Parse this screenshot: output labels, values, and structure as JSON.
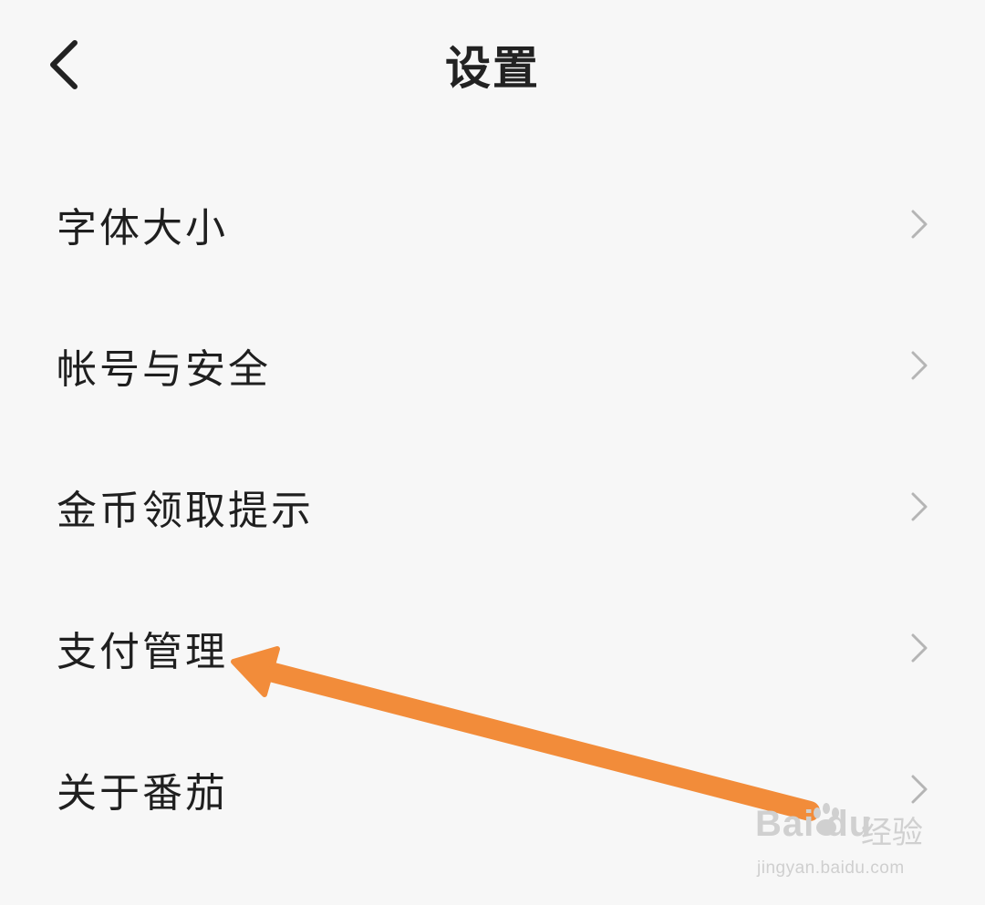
{
  "header": {
    "title": "设置",
    "back_icon": "chevron-left-icon"
  },
  "menu": {
    "items": [
      {
        "label": "字体大小",
        "icon": "chevron-right-icon"
      },
      {
        "label": "帐号与安全",
        "icon": "chevron-right-icon"
      },
      {
        "label": "金币领取提示",
        "icon": "chevron-right-icon"
      },
      {
        "label": "支付管理",
        "icon": "chevron-right-icon"
      },
      {
        "label": "关于番茄",
        "icon": "chevron-right-icon"
      }
    ]
  },
  "annotation": {
    "arrow_color": "#f28c3a",
    "points_to": "支付管理"
  },
  "watermark": {
    "brand": "Bai du",
    "product": "经验",
    "url": "jingyan.baidu.com"
  },
  "colors": {
    "background": "#f7f7f7",
    "text": "#1f1f1f",
    "chevron": "#b5b5b5"
  }
}
